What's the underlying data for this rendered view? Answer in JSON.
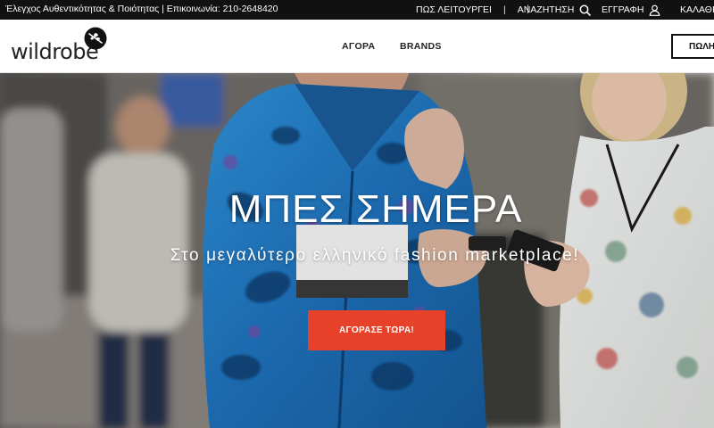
{
  "topbar": {
    "info": "Έλεγχος Αυθεντικότητας & Ποιότητας | Επικοινωνία: 210-2648420",
    "how_it_works": "ΠΩΣ ΛΕΙΤΟΥΡΓΕΙ",
    "separator": "|",
    "search": "ΑΝΑΖΗΤΗΣΗ",
    "register": "ΕΓΓΡΑΦΗ",
    "cart": "ΚΑΛΑΘΙ",
    "search_icon": "search-icon",
    "user_icon": "user-icon"
  },
  "header": {
    "logo_text": "wildrobe",
    "logo_icon": "dragonfly-icon",
    "nav": {
      "shop": "ΑΓΟΡΑ",
      "brands": "BRANDS"
    },
    "sell_button": "ΠΩΛΗΣΕ"
  },
  "hero": {
    "title": "ΜΠΕΣ ΣΗΜΕΡΑ",
    "subtitle": "Στο μεγαλύτερο ελληνικό fashion marketplace!",
    "cta": "ΑΓΟΡΑΣΕ ΤΩΡΑ!"
  },
  "colors": {
    "topbar_bg": "#111111",
    "accent": "#e8412a",
    "text_dark": "#222222"
  }
}
